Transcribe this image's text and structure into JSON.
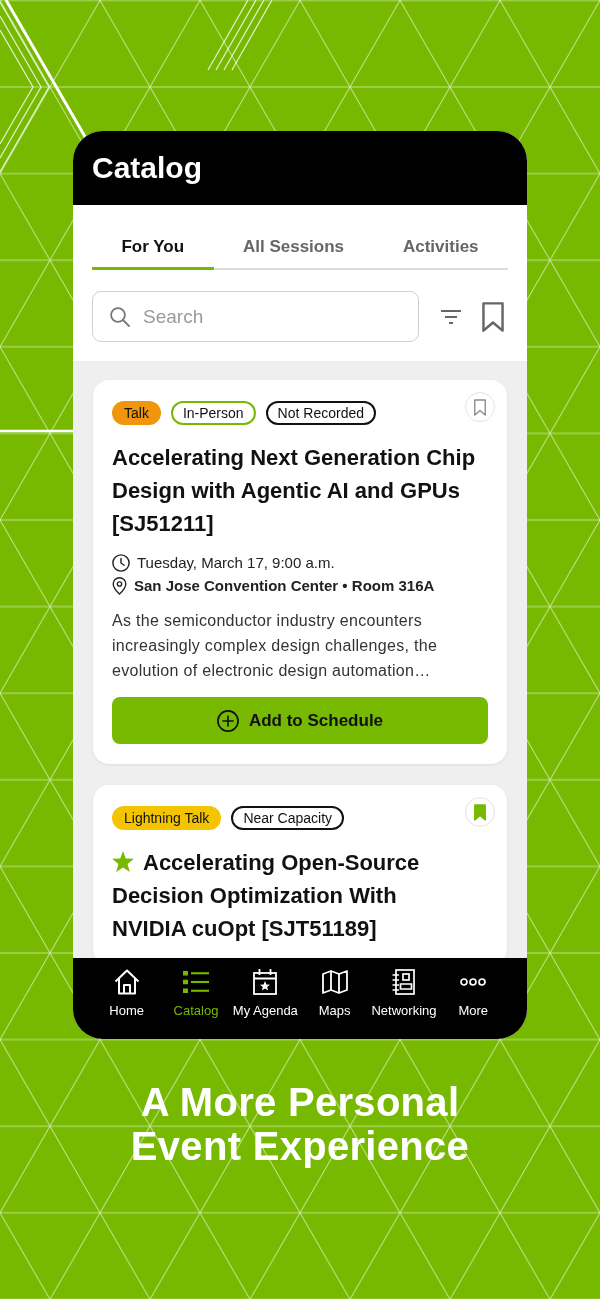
{
  "header": {
    "title": "Catalog"
  },
  "tabs": [
    {
      "label": "For You",
      "selected": true
    },
    {
      "label": "All Sessions",
      "selected": false
    },
    {
      "label": "Activities",
      "selected": false
    }
  ],
  "search": {
    "placeholder": "Search"
  },
  "cards": [
    {
      "tags": [
        {
          "label": "Talk",
          "kind": "filled",
          "color": "#ef960d"
        },
        {
          "label": "In-Person",
          "kind": "outline",
          "color": "#76b900"
        },
        {
          "label": "Not Recorded",
          "kind": "outline",
          "color": "#111111"
        }
      ],
      "bookmarked": false,
      "starred": false,
      "title": "Accelerating Next Generation Chip Design with Agentic AI and GPUs [SJ51211]",
      "date": "Tuesday, March 17, 9:00 a.m.",
      "location": "San Jose Convention Center • Room 316A",
      "description": "As the semiconductor industry encounters increasingly complex design challenges, the evolution of electronic design automation…",
      "action": "Add to Schedule"
    },
    {
      "tags": [
        {
          "label": "Lightning Talk",
          "kind": "filled",
          "color": "#f5c400"
        },
        {
          "label": "Near Capacity",
          "kind": "outline",
          "color": "#111111"
        }
      ],
      "bookmarked": true,
      "starred": true,
      "title": "Accelerating Open-Source Decision Optimization With NVIDIA cuOpt [SJT51189]"
    }
  ],
  "nav": [
    {
      "label": "Home",
      "kind": "home",
      "selected": false
    },
    {
      "label": "Catalog",
      "kind": "catalog",
      "selected": true
    },
    {
      "label": "My Agenda",
      "kind": "agenda",
      "selected": false
    },
    {
      "label": "Maps",
      "kind": "maps",
      "selected": false
    },
    {
      "label": "Networking",
      "kind": "networking",
      "selected": false
    },
    {
      "label": "More",
      "kind": "more",
      "selected": false
    }
  ],
  "tagline": [
    "A More Personal",
    "Event Experience"
  ]
}
